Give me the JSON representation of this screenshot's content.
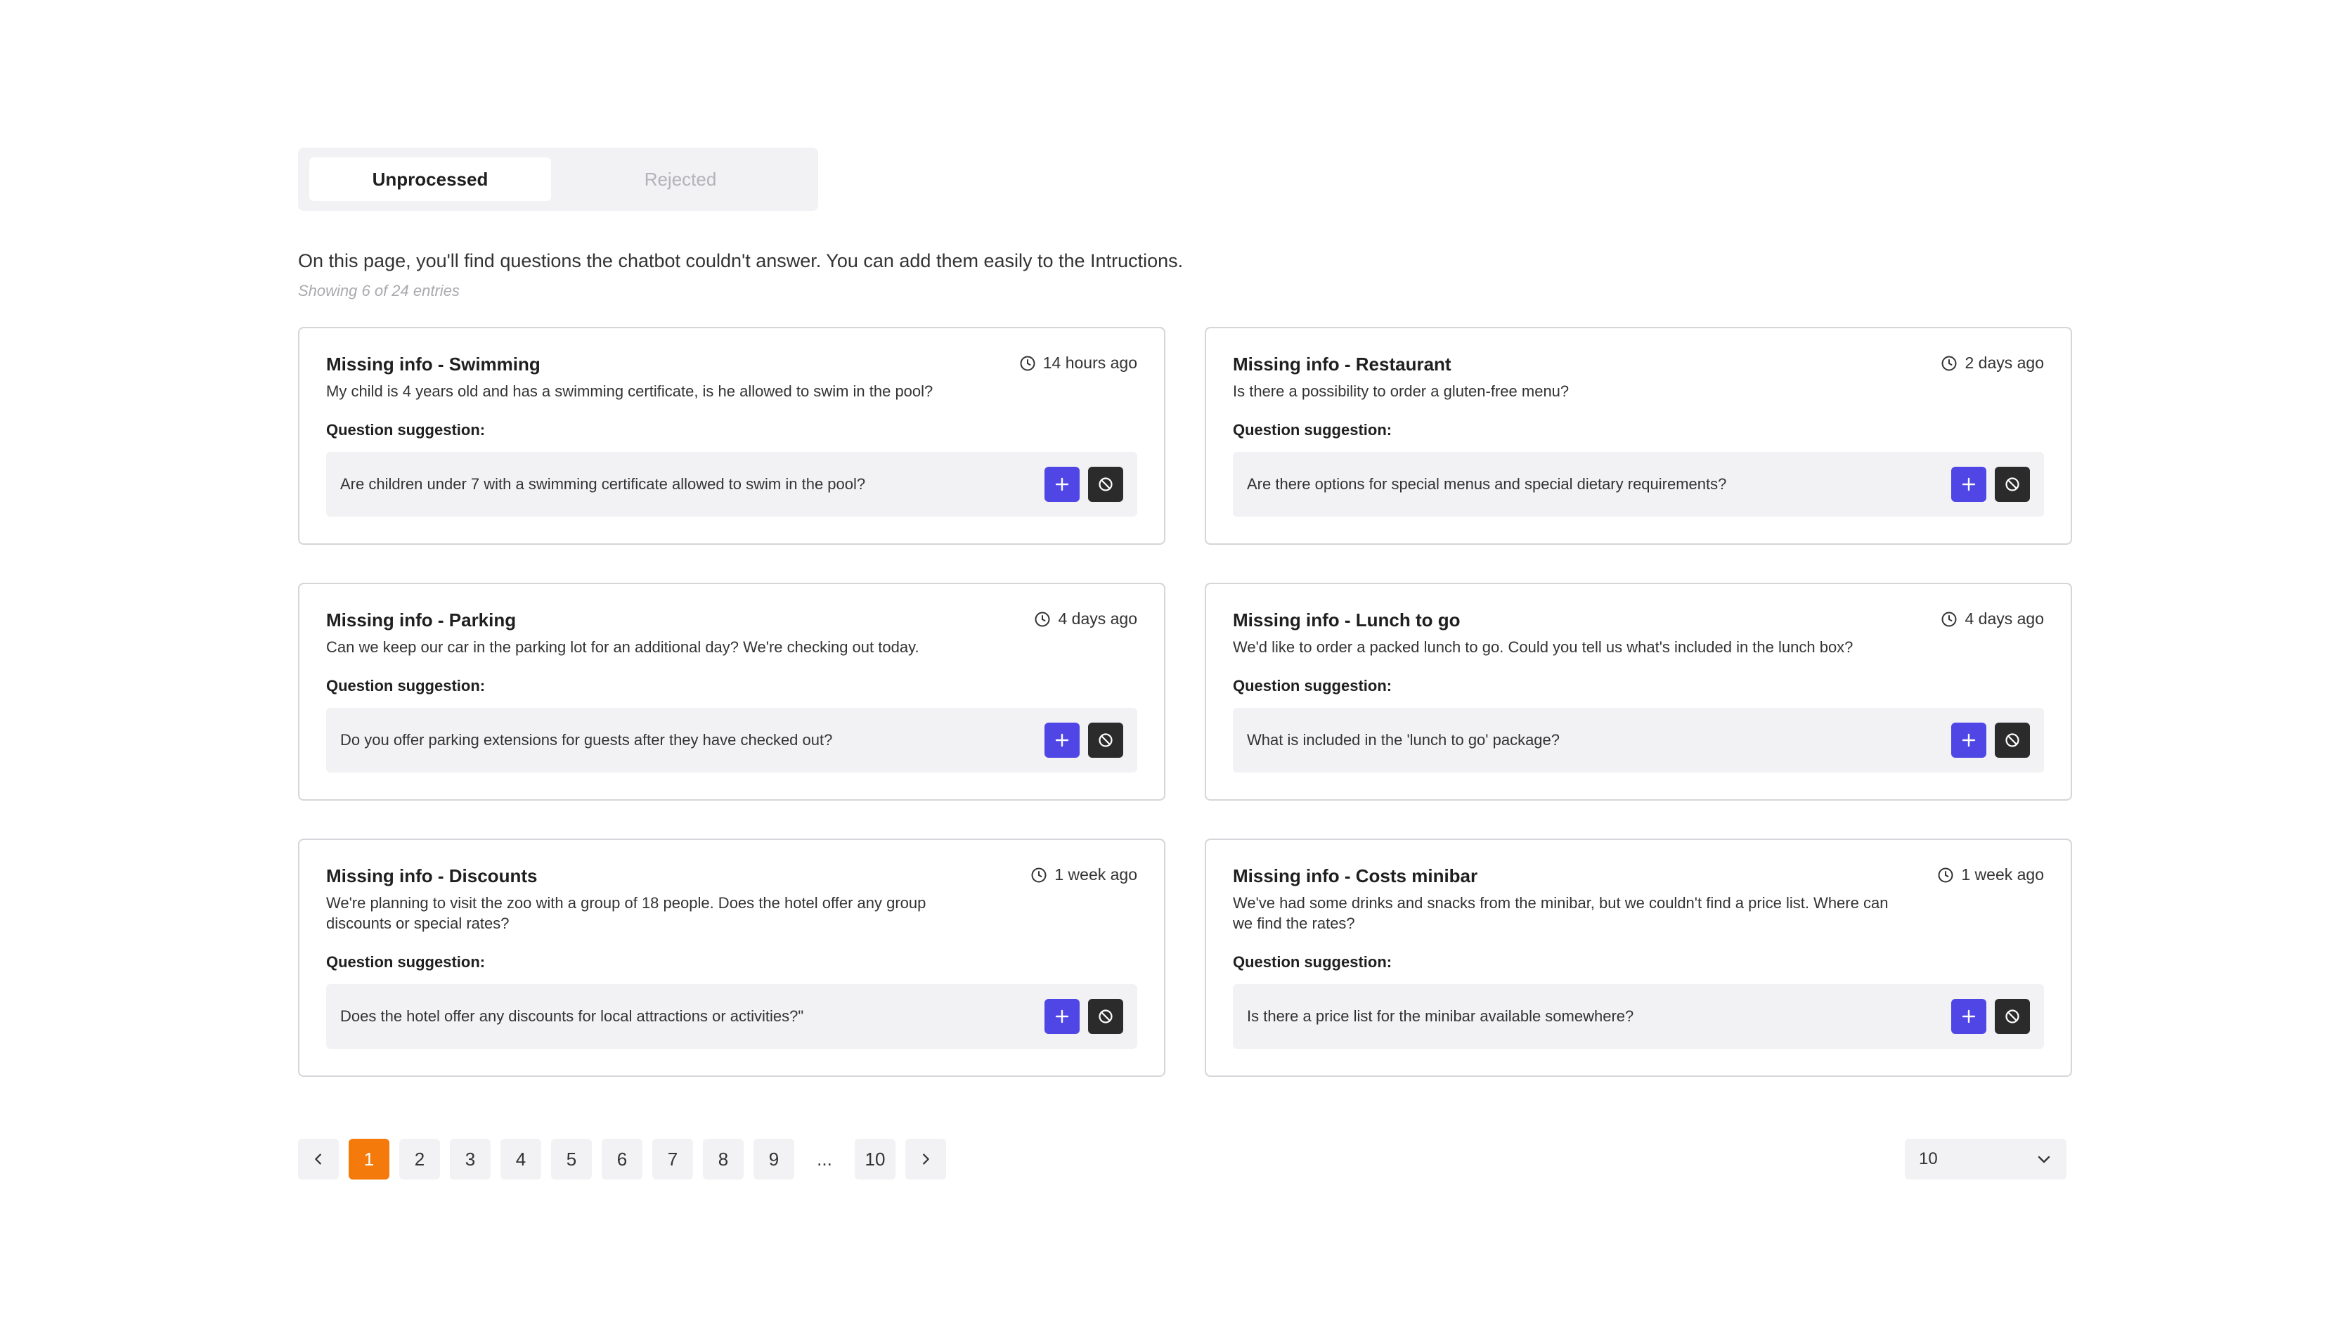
{
  "tabs": [
    {
      "label": "Unprocessed",
      "active": true
    },
    {
      "label": "Rejected",
      "active": false
    }
  ],
  "intro": "On this page, you'll find questions the chatbot couldn't answer.  You can add them easily to the Intructions.",
  "showing": "Showing 6 of 24 entries",
  "suggestion_label": "Question suggestion:",
  "cards": [
    {
      "title": "Missing info - Swimming",
      "time": "14 hours ago",
      "question": "My child is 4 years old and has a swimming certificate, is he allowed to swim in the pool?",
      "suggestion": "Are children under 7 with a swimming certificate allowed to swim in the pool?"
    },
    {
      "title": "Missing info - Restaurant",
      "time": "2 days ago",
      "question": "Is there a possibility to order a gluten-free menu?",
      "suggestion": "Are there options for special menus and special dietary requirements?"
    },
    {
      "title": "Missing info - Parking",
      "time": "4 days ago",
      "question": "Can we keep our car in the parking lot for an additional day? We're checking out today.",
      "suggestion": "Do you offer parking extensions for guests after they have checked out?"
    },
    {
      "title": "Missing info - Lunch to go",
      "time": "4 days ago",
      "question": "We'd like to order a packed lunch to go. Could you tell us what's included in the lunch box?",
      "suggestion": "What is included in the 'lunch to go' package?"
    },
    {
      "title": "Missing info - Discounts",
      "time": "1 week ago",
      "question": "We're planning to visit the zoo with a group of 18 people. Does the hotel offer any group discounts or special rates?",
      "suggestion": "Does the hotel offer any discounts for local attractions or activities?\""
    },
    {
      "title": "Missing info - Costs minibar",
      "time": "1 week ago",
      "question": "We've had some drinks and snacks from the minibar, but we couldn't find a price list. Where can we find the rates?",
      "suggestion": "Is there a price list for the minibar available somewhere?"
    }
  ],
  "pagination": {
    "pages": [
      "1",
      "2",
      "3",
      "4",
      "5",
      "6",
      "7",
      "8",
      "9",
      "...",
      "10"
    ],
    "current": "1"
  },
  "per_page": {
    "value": "10"
  },
  "colors": {
    "accent": "#5046e5",
    "active_page": "#f47a0b",
    "reject": "#2b2b2b"
  },
  "icons": {
    "time": "clock-icon",
    "add": "plus-icon",
    "reject": "block-icon",
    "prev": "chevron-left-icon",
    "next": "chevron-right-icon",
    "dropdown": "chevron-down-icon"
  }
}
